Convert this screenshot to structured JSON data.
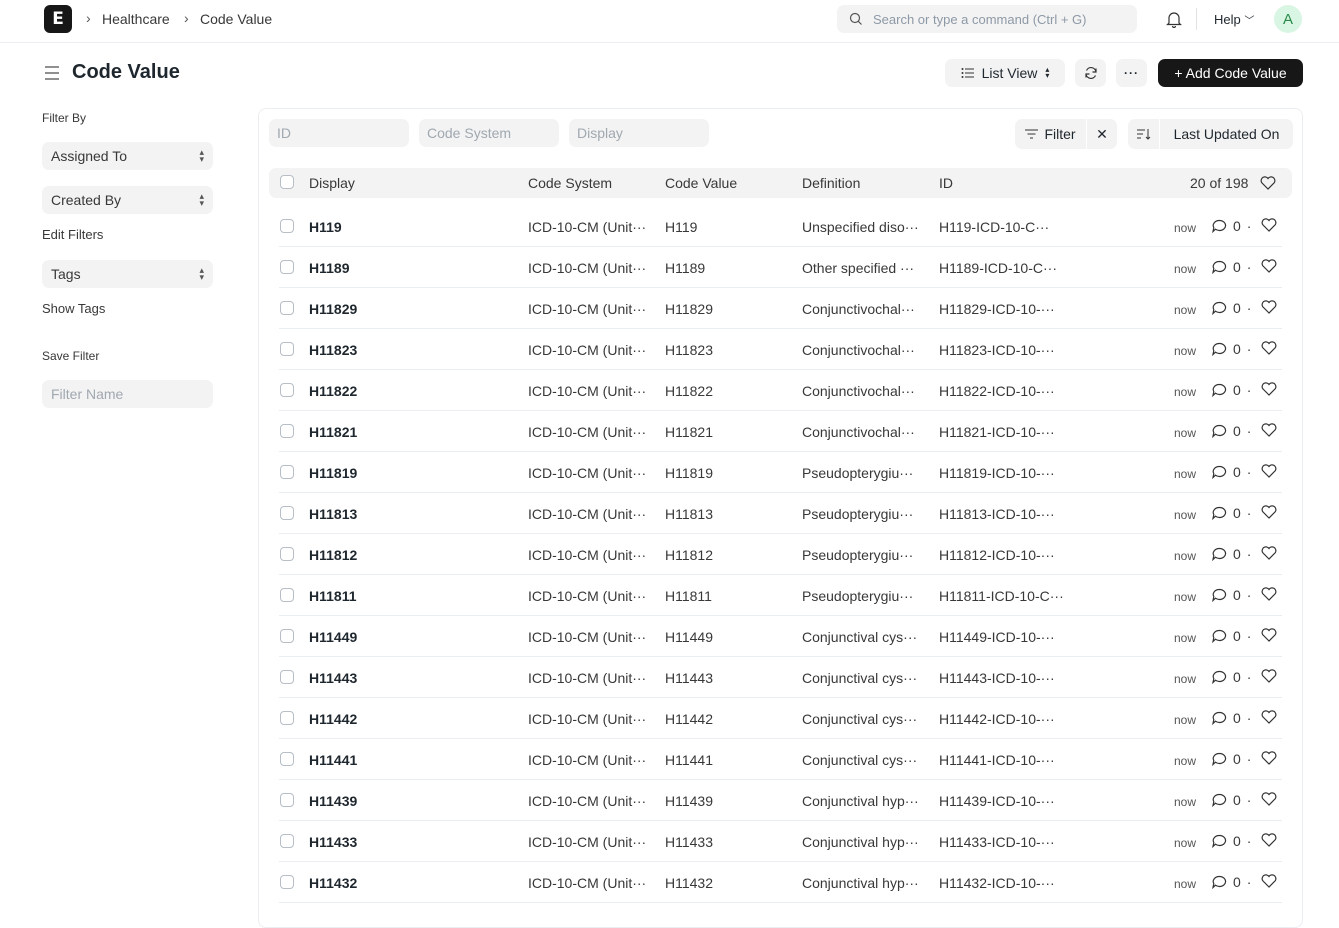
{
  "topbar": {
    "logo_letter": "E",
    "breadcrumbs": [
      "Healthcare",
      "Code Value"
    ],
    "search_placeholder": "Search or type a command (Ctrl + G)",
    "help_label": "Help",
    "avatar_letter": "A"
  },
  "page": {
    "title": "Code Value",
    "list_view_label": "List View",
    "add_button_label": "+ Add Code Value"
  },
  "sidebar": {
    "filter_by_label": "Filter By",
    "assigned_to": "Assigned To",
    "created_by": "Created By",
    "edit_filters": "Edit Filters",
    "tags": "Tags",
    "show_tags": "Show Tags",
    "save_filter_label": "Save Filter",
    "filter_name_placeholder": "Filter Name"
  },
  "filters": {
    "id_placeholder": "ID",
    "code_system_placeholder": "Code System",
    "display_placeholder": "Display",
    "filter_label": "Filter",
    "sort_label": "Last Updated On"
  },
  "table": {
    "headers": {
      "display": "Display",
      "code_system": "Code System",
      "code_value": "Code Value",
      "definition": "Definition",
      "id": "ID",
      "count": "20 of 198"
    },
    "rows": [
      {
        "display": "H119",
        "code_system": "ICD-10-CM (Unit···",
        "code_value": "H119",
        "definition": "Unspecified diso···",
        "id": "H119-ICD-10-C···",
        "time": "now",
        "comments": "0"
      },
      {
        "display": "H1189",
        "code_system": "ICD-10-CM (Unit···",
        "code_value": "H1189",
        "definition": "Other specified ···",
        "id": "H1189-ICD-10-C···",
        "time": "now",
        "comments": "0"
      },
      {
        "display": "H11829",
        "code_system": "ICD-10-CM (Unit···",
        "code_value": "H11829",
        "definition": "Conjunctivochal···",
        "id": "H11829-ICD-10-···",
        "time": "now",
        "comments": "0"
      },
      {
        "display": "H11823",
        "code_system": "ICD-10-CM (Unit···",
        "code_value": "H11823",
        "definition": "Conjunctivochal···",
        "id": "H11823-ICD-10-···",
        "time": "now",
        "comments": "0"
      },
      {
        "display": "H11822",
        "code_system": "ICD-10-CM (Unit···",
        "code_value": "H11822",
        "definition": "Conjunctivochal···",
        "id": "H11822-ICD-10-···",
        "time": "now",
        "comments": "0"
      },
      {
        "display": "H11821",
        "code_system": "ICD-10-CM (Unit···",
        "code_value": "H11821",
        "definition": "Conjunctivochal···",
        "id": "H11821-ICD-10-···",
        "time": "now",
        "comments": "0"
      },
      {
        "display": "H11819",
        "code_system": "ICD-10-CM (Unit···",
        "code_value": "H11819",
        "definition": "Pseudopterygiu···",
        "id": "H11819-ICD-10-···",
        "time": "now",
        "comments": "0"
      },
      {
        "display": "H11813",
        "code_system": "ICD-10-CM (Unit···",
        "code_value": "H11813",
        "definition": "Pseudopterygiu···",
        "id": "H11813-ICD-10-···",
        "time": "now",
        "comments": "0"
      },
      {
        "display": "H11812",
        "code_system": "ICD-10-CM (Unit···",
        "code_value": "H11812",
        "definition": "Pseudopterygiu···",
        "id": "H11812-ICD-10-···",
        "time": "now",
        "comments": "0"
      },
      {
        "display": "H11811",
        "code_system": "ICD-10-CM (Unit···",
        "code_value": "H11811",
        "definition": "Pseudopterygiu···",
        "id": "H11811-ICD-10-C···",
        "time": "now",
        "comments": "0"
      },
      {
        "display": "H11449",
        "code_system": "ICD-10-CM (Unit···",
        "code_value": "H11449",
        "definition": "Conjunctival cys···",
        "id": "H11449-ICD-10-···",
        "time": "now",
        "comments": "0"
      },
      {
        "display": "H11443",
        "code_system": "ICD-10-CM (Unit···",
        "code_value": "H11443",
        "definition": "Conjunctival cys···",
        "id": "H11443-ICD-10-···",
        "time": "now",
        "comments": "0"
      },
      {
        "display": "H11442",
        "code_system": "ICD-10-CM (Unit···",
        "code_value": "H11442",
        "definition": "Conjunctival cys···",
        "id": "H11442-ICD-10-···",
        "time": "now",
        "comments": "0"
      },
      {
        "display": "H11441",
        "code_system": "ICD-10-CM (Unit···",
        "code_value": "H11441",
        "definition": "Conjunctival cys···",
        "id": "H11441-ICD-10-···",
        "time": "now",
        "comments": "0"
      },
      {
        "display": "H11439",
        "code_system": "ICD-10-CM (Unit···",
        "code_value": "H11439",
        "definition": "Conjunctival hyp···",
        "id": "H11439-ICD-10-···",
        "time": "now",
        "comments": "0"
      },
      {
        "display": "H11433",
        "code_system": "ICD-10-CM (Unit···",
        "code_value": "H11433",
        "definition": "Conjunctival hyp···",
        "id": "H11433-ICD-10-···",
        "time": "now",
        "comments": "0"
      },
      {
        "display": "H11432",
        "code_system": "ICD-10-CM (Unit···",
        "code_value": "H11432",
        "definition": "Conjunctival hyp···",
        "id": "H11432-ICD-10-···",
        "time": "now",
        "comments": "0"
      }
    ]
  }
}
